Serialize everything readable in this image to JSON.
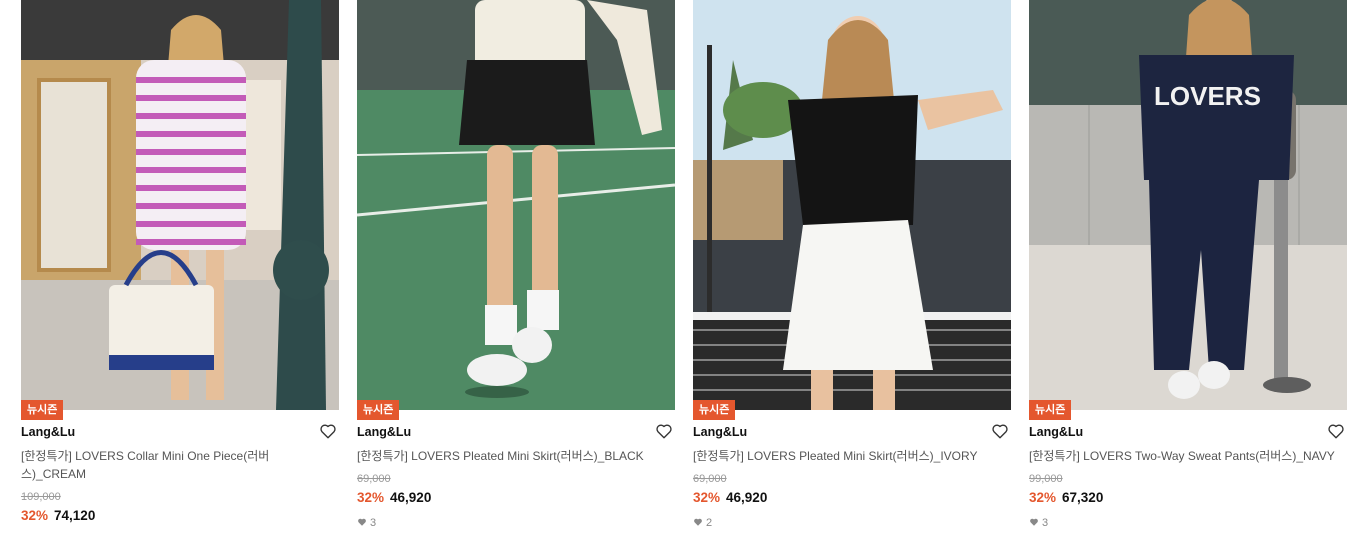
{
  "products": [
    {
      "badge": "뉴시즌",
      "brand": "Lang&Lu",
      "name": "[한정특가] LOVERS Collar Mini One Piece(러버스)_CREAM",
      "original_price": "109,000",
      "discount": "32%",
      "price": "74,120",
      "likes": "",
      "image": "woman-striped-dress-tote-bag"
    },
    {
      "badge": "뉴시즌",
      "brand": "Lang&Lu",
      "name": "[한정특가] LOVERS Pleated Mini Skirt(러버스)_BLACK",
      "original_price": "69,000",
      "discount": "32%",
      "price": "46,920",
      "likes": "3",
      "image": "woman-black-skirt-tennis-court"
    },
    {
      "badge": "뉴시즌",
      "brand": "Lang&Lu",
      "name": "[한정특가] LOVERS Pleated Mini Skirt(러버스)_IVORY",
      "original_price": "69,000",
      "discount": "32%",
      "price": "46,920",
      "likes": "2",
      "image": "woman-ivory-skirt-tennis-net"
    },
    {
      "badge": "뉴시즌",
      "brand": "Lang&Lu",
      "name": "[한정특가] LOVERS Two-Way Sweat Pants(러버스)_NAVY",
      "original_price": "99,000",
      "discount": "32%",
      "price": "67,320",
      "likes": "3",
      "image": "woman-navy-sweat-set",
      "sweatshirt_text": "LOVERS"
    }
  ],
  "colors": {
    "discount": "#e4572e",
    "badge": "#e4572e"
  }
}
